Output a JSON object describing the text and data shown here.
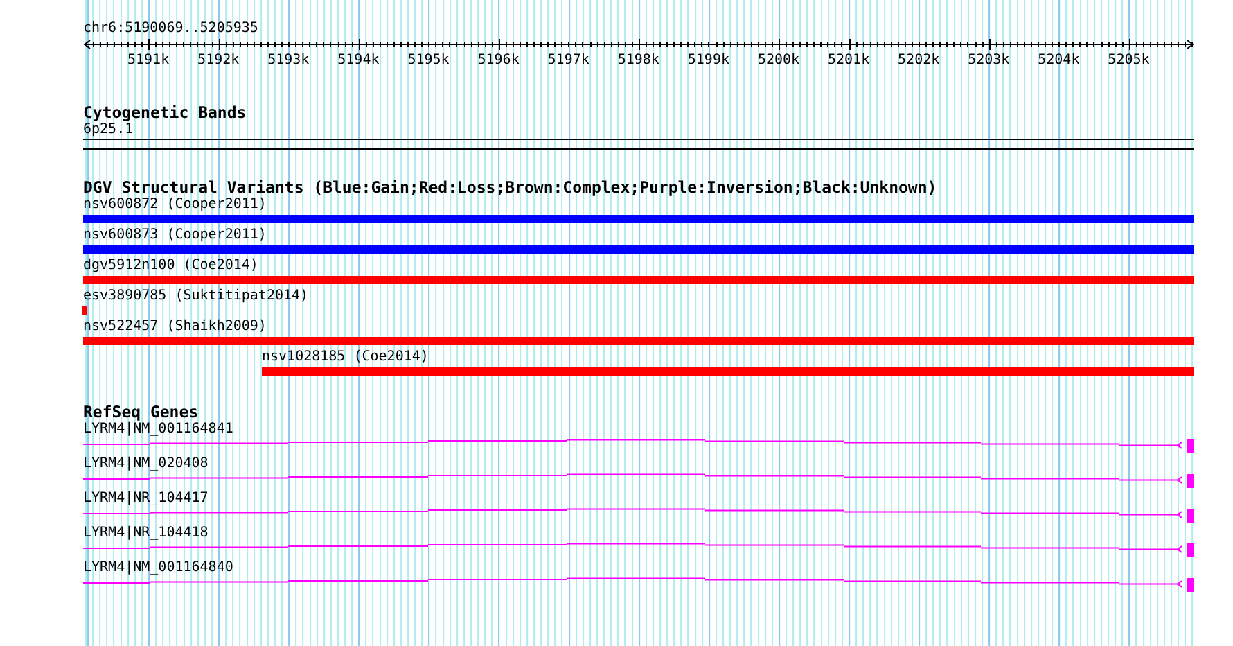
{
  "location": "chr6:5190069..5205935",
  "ruler": {
    "ticks": [
      "5191k",
      "5192k",
      "5193k",
      "5194k",
      "5195k",
      "5196k",
      "5197k",
      "5198k",
      "5199k",
      "5200k",
      "5201k",
      "5202k",
      "5203k",
      "5204k",
      "5205k"
    ]
  },
  "cytogenetic_bands": {
    "title": "Cytogenetic Bands",
    "band": "6p25.1"
  },
  "dgv_variants": {
    "title": "DGV Structural Variants (Blue:Gain;Red:Loss;Brown:Complex;Purple:Inversion;Black:Unknown)",
    "items": [
      {
        "label": "nsv600872 (Cooper2011)",
        "color": "#0000ff",
        "kind": "full"
      },
      {
        "label": "nsv600873 (Cooper2011)",
        "color": "#0000ff",
        "kind": "full"
      },
      {
        "label": "dgv5912n100 (Coe2014)",
        "color": "#ff0000",
        "kind": "full"
      },
      {
        "label": "esv3890785 (Suktitipat2014)",
        "color": "#ff0000",
        "kind": "point"
      },
      {
        "label": "nsv522457 (Shaikh2009)",
        "color": "#ff0000",
        "kind": "full"
      },
      {
        "label": "nsv1028185 (Coe2014)",
        "color": "#ff0000",
        "kind": "partial"
      }
    ]
  },
  "refseq_genes": {
    "title": "RefSeq Genes",
    "items": [
      {
        "label": "LYRM4|NM_001164841"
      },
      {
        "label": "LYRM4|NM_020408"
      },
      {
        "label": "LYRM4|NR_104417"
      },
      {
        "label": "LYRM4|NR_104418"
      },
      {
        "label": "LYRM4|NM_001164840"
      }
    ]
  }
}
